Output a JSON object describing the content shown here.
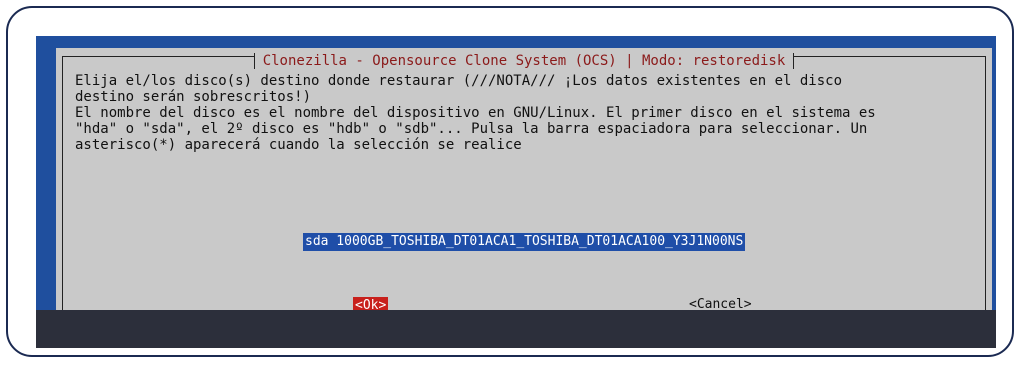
{
  "dialog": {
    "title": "Clonezilla - Opensource Clone System (OCS) | Modo: restoredisk",
    "lines": [
      "Elija el/los disco(s) destino donde restaurar (///NOTA/// ¡Los datos existentes en el disco",
      "destino serán sobrescritos!)",
      "El nombre del disco es el nombre del dispositivo en GNU/Linux. El primer disco en el sistema es",
      "\"hda\" o \"sda\", el 2º disco es \"hdb\" o \"sdb\"... Pulsa la barra espaciadora para seleccionar. Un",
      "asterisco(*) aparecerá cuando la selección se realice"
    ],
    "disk_item": "sda 1000GB_TOSHIBA_DT01ACA1_TOSHIBA_DT01ACA100_Y3J1N00NS",
    "ok_label": "<Ok>",
    "cancel_label": "<Cancel>"
  },
  "colors": {
    "background": "#1f4f9e",
    "dialog": "#c9c9c9",
    "title": "#8b1a1a",
    "selection": "#1f4ea8",
    "ok_button": "#c8201c"
  }
}
